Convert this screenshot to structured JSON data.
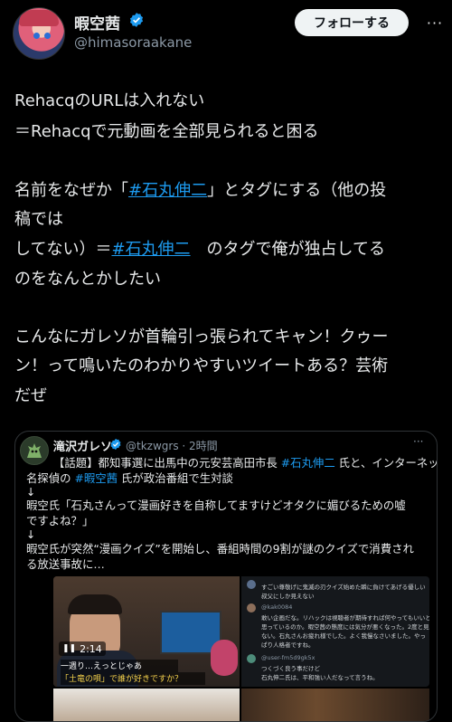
{
  "header": {
    "display_name": "暇空茜",
    "handle": "@himasoraakane",
    "follow_label": "フォローする",
    "more_label": "···"
  },
  "tweet": {
    "line1": "RehacqのURLは入れない",
    "line2": "＝Rehacqで元動画を全部見られると困る",
    "line3_pre": "名前をなぜか「",
    "line3_tag": "#石丸伸二",
    "line3_post": "」とタグにする（他の投",
    "line4": "稿では",
    "line5_pre": "してない）＝",
    "line5_tag": "#石丸伸二",
    "line5_post": "　のタグで俺が独占してる",
    "line6": "のをなんとかしたい",
    "line7": "こんなにガレソが首輪引っ張られてキャン！クゥー",
    "line8": "ン！って鳴いたのわかりやすいツイートある？芸術",
    "line9": "だぜ"
  },
  "quote": {
    "name": "滝沢ガレソ",
    "handle_time": "@tkzwgrs · 2時間",
    "more": "···",
    "q1_pre": "【話題】都知事選に出馬中の元安芸高田市長 ",
    "q1_tag": "#石丸伸二",
    "q1_post": " 氏と、インターネット",
    "q2_pre": "名探偵の ",
    "q2_tag": "#暇空茜",
    "q2_post": " 氏が政治番組で生対談",
    "q3": "↓",
    "q4": "暇空氏「石丸さんって漫画好きを自称してますけどオタクに媚びるための嘘",
    "q5": "ですよね？」",
    "q6": "↓",
    "q7": "暇空氏が突然“漫画クイズ”を開始し、番組時間の9割が謎のクイズで消費され",
    "q8": "る放送事故に…",
    "video_time": "2:14",
    "caption1": "一週り…えっとじゃあ",
    "caption2": "「土竜の唄」で誰が好きですか？",
    "comments": [
      "すごい尊敬げに鬼滅の刃クイズ始めた瞬に負けてあげる優しい",
      "叔父にしか見えない",
      "@kak0084",
      "敢い企画だな。リハックは視聴者が期待すれば何やってもいいと",
      "思っているのか。暇空茜の態度には気分が悪くなった。2度と見",
      "ない。石丸さんお疲れ様でした。よく我慢なさいました。やっ",
      "ぱり人格者ですね。",
      "@user-fm5d9gk5x",
      "つくづく良う事だけど",
      "石丸伸二氏は、平和強い人だなって言うね。"
    ]
  },
  "colors": {
    "background": "#000000",
    "text": "#e7e9ea",
    "secondary": "#8b98a5",
    "link": "#1d9bf0",
    "verified": "#1d9bf0"
  }
}
